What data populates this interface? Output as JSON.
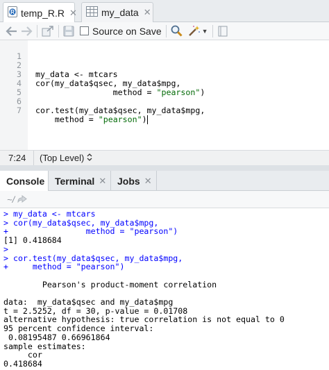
{
  "editor_tabs": [
    {
      "label": "temp_R.R",
      "icon": "r-script-icon",
      "active": true
    },
    {
      "label": "my_data",
      "icon": "table-icon",
      "active": false
    }
  ],
  "toolbar": {
    "source_on_save_label": "Source on Save",
    "source_on_save_checked": false,
    "icons": [
      "back-arrow-icon",
      "forward-arrow-icon",
      "show-in-window-icon",
      "save-icon",
      "search-icon",
      "code-tools-wand-icon",
      "compile-report-icon"
    ]
  },
  "editor": {
    "line_numbers": [
      "1",
      "2",
      "3",
      "4",
      "5",
      "6",
      "7"
    ],
    "lines": [
      {
        "segments": [
          ""
        ]
      },
      {
        "segments": [
          "my_data <- mtcars"
        ]
      },
      {
        "segments": [
          "cor(my_data$qsec, my_data$mpg,"
        ]
      },
      {
        "segments": [
          "                method = ",
          "\"pearson\"",
          ")"
        ]
      },
      {
        "segments": [
          ""
        ]
      },
      {
        "segments": [
          "cor.test(my_data$qsec, my_data$mpg,"
        ]
      },
      {
        "segments": [
          "    method = ",
          "\"pearson\"",
          ")"
        ]
      }
    ]
  },
  "status": {
    "cursor_position": "7:24",
    "scope": "(Top Level)"
  },
  "console_tabs": [
    {
      "label": "Console",
      "active": true
    },
    {
      "label": "Terminal",
      "active": false
    },
    {
      "label": "Jobs",
      "active": false
    }
  ],
  "console_path": "~/",
  "console_lines": [
    {
      "type": "input",
      "text": "> my_data <- mtcars"
    },
    {
      "type": "input",
      "text": "> cor(my_data$qsec, my_data$mpg,"
    },
    {
      "type": "input",
      "text": "+                method = \"pearson\")"
    },
    {
      "type": "output",
      "text": "[1] 0.418684"
    },
    {
      "type": "input",
      "text": ">"
    },
    {
      "type": "input",
      "text": "> cor.test(my_data$qsec, my_data$mpg,"
    },
    {
      "type": "input",
      "text": "+     method = \"pearson\")"
    },
    {
      "type": "output",
      "text": ""
    },
    {
      "type": "output",
      "text": "        Pearson's product-moment correlation"
    },
    {
      "type": "output",
      "text": ""
    },
    {
      "type": "output",
      "text": "data:  my_data$qsec and my_data$mpg"
    },
    {
      "type": "output",
      "text": "t = 2.5252, df = 30, p-value = 0.01708"
    },
    {
      "type": "output",
      "text": "alternative hypothesis: true correlation is not equal to 0"
    },
    {
      "type": "output",
      "text": "95 percent confidence interval:"
    },
    {
      "type": "output",
      "text": " 0.08195487 0.66961864"
    },
    {
      "type": "output",
      "text": "sample estimates:"
    },
    {
      "type": "output",
      "text": "     cor"
    },
    {
      "type": "output",
      "text": "0.418684"
    }
  ]
}
